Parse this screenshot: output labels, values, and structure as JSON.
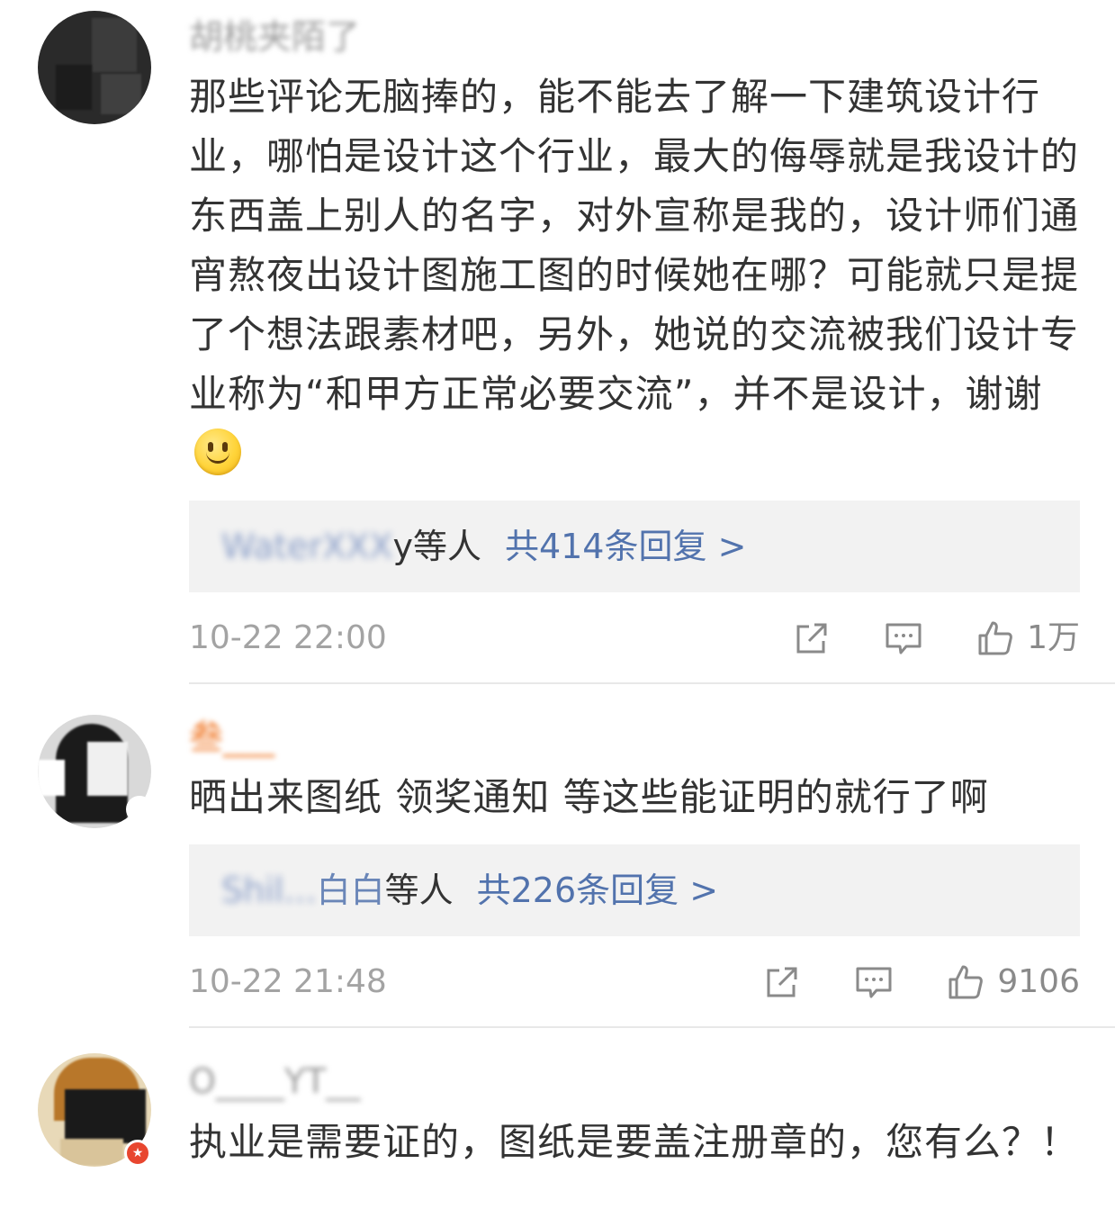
{
  "comments": [
    {
      "username": "胡桃夹陌了",
      "text": "那些评论无脑捧的，能不能去了解一下建筑设计行业，哪怕是设计这个行业，最大的侮辱就是我设计的东西盖上别人的名字，对外宣称是我的，设计师们通宵熬夜出设计图施工图的时候她在哪？可能就只是提了个想法跟素材吧，另外，她说的交流被我们设计专业称为“和甲方正常必要交流”，并不是设计，谢谢",
      "emoji": "smile-emoji",
      "replies": {
        "names_blurred": "WaterXXX",
        "names_suffix": "y",
        "others_label": "等人",
        "total_label": "共414条回复 >"
      },
      "time": "10-22 22:00",
      "like_count": "1万"
    },
    {
      "username": "叁___",
      "text": "晒出来图纸 领奖通知 等这些能证明的就行了啊",
      "replies": {
        "names_blurred": "Shil...",
        "names_suffix": "白白",
        "others_label": "等人",
        "total_label": "共226条回复 >"
      },
      "time": "10-22 21:48",
      "like_count": "9106"
    },
    {
      "username": "O____YT__",
      "text": "执业是需要证的，图纸是要盖注册章的，您有么？！"
    }
  ],
  "icons": {
    "share": "share-icon",
    "comment": "comment-icon",
    "like": "thumb-up-icon"
  },
  "colors": {
    "link": "#5273ad",
    "reply_bg": "#f2f2f2",
    "meta": "#a3a3a3"
  }
}
